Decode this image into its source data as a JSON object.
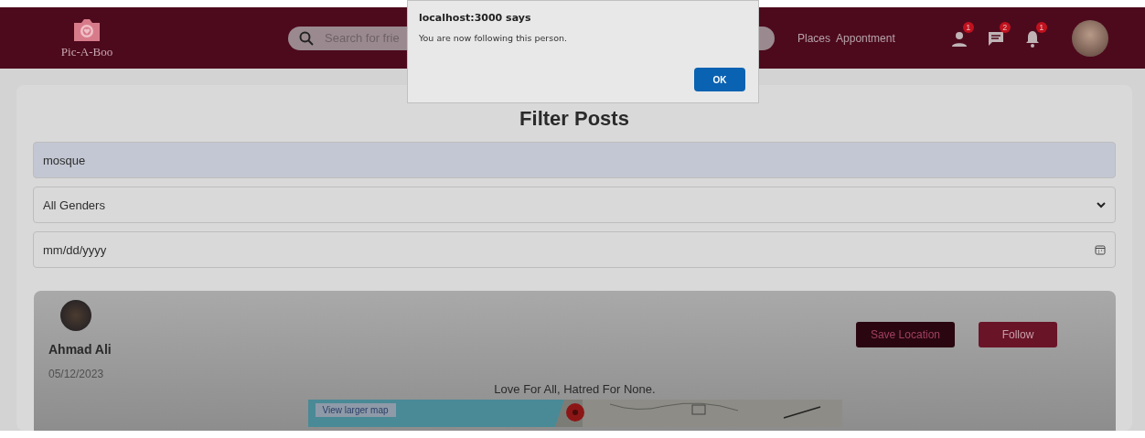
{
  "header": {
    "logo": "Pic-A-Boo",
    "search": {
      "placeholder": "Search for frie"
    },
    "nav": [
      "Places",
      "Appontment"
    ],
    "icons": [
      {
        "kind": "person",
        "badge": "1"
      },
      {
        "kind": "chat",
        "badge": "2"
      },
      {
        "kind": "bell",
        "badge": "1"
      }
    ]
  },
  "filter": {
    "title": "Filter Posts",
    "query": "mosque",
    "gender": "All Genders",
    "date": {
      "placeholder": "mm/dd/yyyy"
    }
  },
  "post": {
    "author": "Ahmad Ali",
    "date": "05/12/2023",
    "buttons": [
      {
        "label": "Save Location",
        "kind": "dark"
      },
      {
        "label": "Follow",
        "kind": "primary"
      }
    ],
    "caption": "Love For All, Hatred For None.",
    "map": {
      "kind": "picture",
      "button": "View larger map"
    }
  },
  "dialog": {
    "title": "localhost:3000 says",
    "message": "You are now following this person.",
    "button": "OK"
  }
}
